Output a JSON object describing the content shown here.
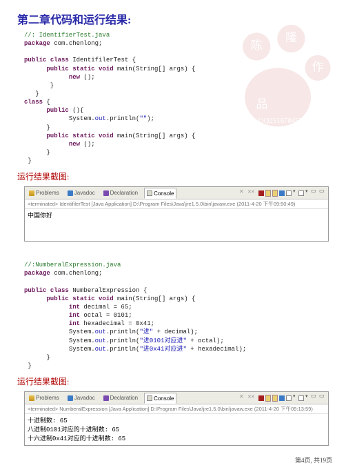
{
  "title": "第二章代码和运行结果:",
  "caption1": "运行结果截图:",
  "caption2": "运行结果截图:",
  "eclipse_tabs": {
    "problems": "Problems",
    "javadoc": "Javadoc",
    "declaration": "Declaration",
    "console": "Console"
  },
  "code1": {
    "c_line": "//: IdentifierTest.java",
    "pkg_kw": "package",
    "pkg_name": " com.chenlong;",
    "pub": "public",
    "cls": "class",
    "id1": " IdentifilerTest {",
    "stat": "static",
    "void": "void",
    "main_sig": " main(String[] args) {",
    "new": "new",
    "paren": " ();",
    "lbrace": " {",
    "rbrace": "}",
    "pub_sig": " (){",
    "sys": "System.",
    "out": "out",
    "println": ".println(",
    "empty": "\"\"",
    "end": ");"
  },
  "console1": {
    "header": "<terminated> IdentifilerTest [Java Application] D:\\Program Files\\Java\\jre1.5.0\\bin\\javaw.exe (2011-4-20 下午09:50:49)",
    "body": "中国你好"
  },
  "code2": {
    "c_line": "//:NumberalExpression.java",
    "pkg_kw": "package",
    "pkg_name": " com.chenlong;",
    "pub": "public",
    "cls": "class",
    "id": " NumberalExpression {",
    "stat": "static",
    "void": "void",
    "main_sig": " main(String[] args) {",
    "int": "int",
    "d1": " decimal = 65;",
    "d2": " octal = 0101;",
    "d3": " hexadecimal = 0x41;",
    "sys": "System.",
    "out": "out",
    "p": ".println(",
    "s1": "\"进\"",
    "a1": " + decimal);",
    "s2": "\"进0101对应进\"",
    "a2": " + octal);",
    "s3": "\"进0x41对应进\"",
    "a3": " + hexadecimal);",
    "rbrace": "}"
  },
  "console2": {
    "header": "<terminated> NumberalExpression [Java Application] D:\\Program Files\\Java\\jre1.5.0\\bin\\javaw.exe (2011-4-20 下午09:13:59)",
    "l1": "十进制数: 65",
    "l2": "八进制0101对应的十进制数: 65",
    "l3": "十六进制0x41对应的十进制数: 65"
  },
  "footer": "第4页, 共19页"
}
